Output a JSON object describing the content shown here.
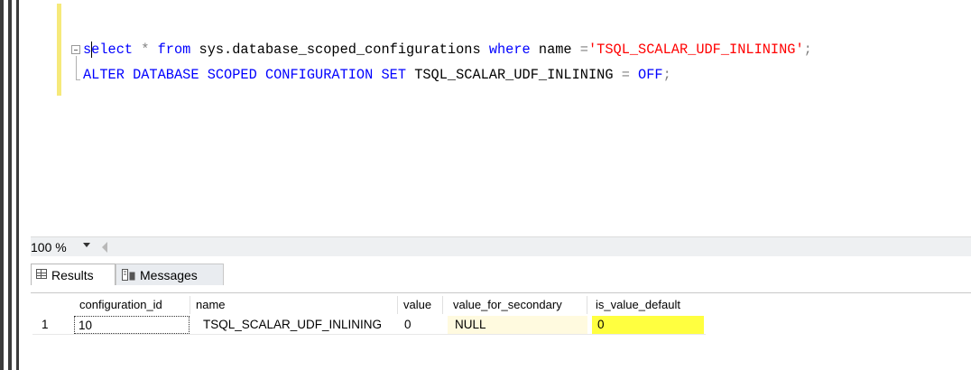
{
  "editor": {
    "line1": {
      "kw1": "select",
      "op1": " * ",
      "kw2": "from",
      "ident": " sys.database_scoped_configurations ",
      "kw3": "where",
      "ident2": " name ",
      "op2": "=",
      "str": "'TSQL_SCALAR_UDF_INLINING'",
      "term": ";"
    },
    "line2": {
      "kw1": "ALTER DATABASE SCOPED CONFIGURATION SET",
      "ident": " TSQL_SCALAR_UDF_INLINING ",
      "op": "=",
      "kw2": " OFF",
      "term": ";"
    }
  },
  "zoom": {
    "label": "100 %"
  },
  "tabs": {
    "results": "Results",
    "messages": "Messages"
  },
  "table": {
    "columns": [
      "configuration_id",
      "name",
      "value",
      "value_for_secondary",
      "is_value_default"
    ],
    "rows": [
      {
        "num": "1",
        "configuration_id": "10",
        "name": "TSQL_SCALAR_UDF_INLINING",
        "value": "0",
        "value_for_secondary": "NULL",
        "is_value_default": "0"
      }
    ]
  },
  "colors": {
    "keyword": "#0000ff",
    "string": "#ff0000",
    "operator": "#808080",
    "highlight": "#ffff40",
    "cell_secondary_bg": "#fffadf"
  }
}
